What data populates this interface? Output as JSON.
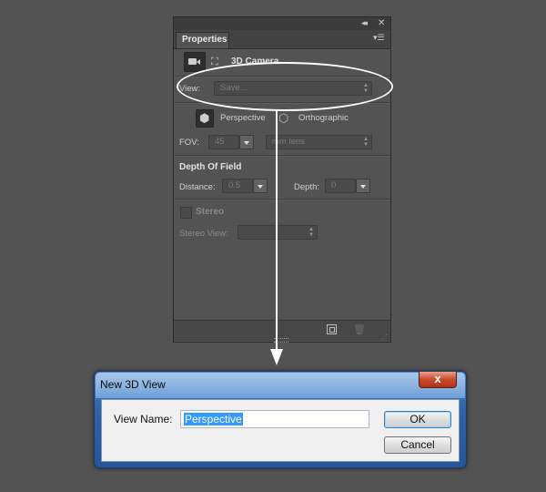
{
  "panel": {
    "tab_title": "Properties",
    "section_title": "3D Camera",
    "view_label": "View:",
    "view_value": "Save...",
    "perspective_label": "Perspective",
    "orthographic_label": "Orthographic",
    "fov_label": "FOV:",
    "fov_value": "45",
    "fov_unit": "mm lens",
    "dof_title": "Depth Of Field",
    "distance_label": "Distance:",
    "distance_value": "0.5",
    "depth_label": "Depth:",
    "depth_value": "0",
    "stereo_label": "Stereo",
    "stereo_view_label": "Stereo View:",
    "stereo_view_value": ""
  },
  "dialog": {
    "title": "New 3D View",
    "close_label": "x",
    "view_name_label": "View Name:",
    "view_name_value": "Perspective",
    "ok_label": "OK",
    "cancel_label": "Cancel"
  },
  "colors": {
    "background": "#535353",
    "annotation": "#ffffff",
    "dialog_frame": "#2f62a6",
    "selection": "#3399ff"
  }
}
